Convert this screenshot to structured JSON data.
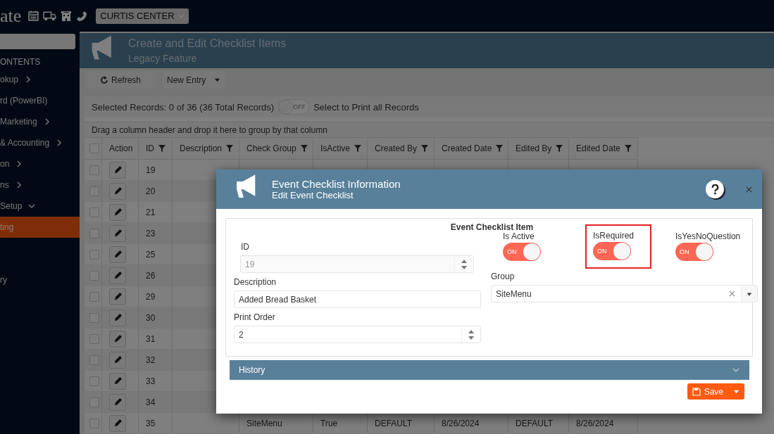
{
  "topbar": {
    "logo": "ate",
    "location": "CURTIS CENTER"
  },
  "sidebar": {
    "heading": "ONTENTS",
    "items": [
      {
        "label": "okup",
        "kind": "group",
        "expanded": false,
        "selected": false
      },
      {
        "label": "rd (PowerBI)",
        "kind": "link",
        "selected": false
      },
      {
        "label": "Marketing",
        "kind": "group",
        "expanded": false,
        "selected": false
      },
      {
        "label": "& Accounting",
        "kind": "group",
        "expanded": false,
        "selected": false
      },
      {
        "label": "on",
        "kind": "group",
        "expanded": false,
        "selected": false
      },
      {
        "label": "ns",
        "kind": "group",
        "expanded": false,
        "selected": false
      },
      {
        "label": "Setup",
        "kind": "group",
        "expanded": true,
        "selected": false
      },
      {
        "label": "ting",
        "kind": "link",
        "selected": true
      },
      {
        "label": "ry",
        "kind": "link",
        "selected": false
      }
    ]
  },
  "page_header": {
    "title": "Create and Edit Checklist Items",
    "subtitle": "Legacy Feature"
  },
  "toolbar": {
    "refresh": "Refresh",
    "new_entry": "New Entry"
  },
  "selection_bar": {
    "summary": "Selected Records: 0 of 36 (36 Total Records)",
    "print_toggle": {
      "text": "OFF",
      "on": false
    },
    "print_label": "Select to Print all Records"
  },
  "group_hint": "Drag a column header and drop it here to group by that column",
  "table": {
    "select_all_checked": false,
    "columns": [
      {
        "label": "Action",
        "kind": "action",
        "filterable": false
      },
      {
        "label": "ID",
        "kind": "text",
        "filterable": true
      },
      {
        "label": "Description",
        "kind": "text",
        "filterable": true
      },
      {
        "label": "Check Group",
        "kind": "text",
        "filterable": true
      },
      {
        "label": "IsActive",
        "kind": "text",
        "filterable": true
      },
      {
        "label": "Created By",
        "kind": "text",
        "filterable": true
      },
      {
        "label": "Created Date",
        "kind": "text",
        "filterable": true
      },
      {
        "label": "Edited By",
        "kind": "text",
        "filterable": true
      },
      {
        "label": "Edited Date",
        "kind": "text",
        "filterable": true
      }
    ],
    "rows": [
      {
        "checked": false,
        "cells": [
          null,
          "19"
        ]
      },
      {
        "checked": false,
        "cells": [
          null,
          "20"
        ]
      },
      {
        "checked": false,
        "cells": [
          null,
          "21"
        ]
      },
      {
        "checked": false,
        "cells": [
          null,
          "23"
        ]
      },
      {
        "checked": false,
        "cells": [
          null,
          "25"
        ]
      },
      {
        "checked": false,
        "cells": [
          null,
          "26"
        ]
      },
      {
        "checked": false,
        "cells": [
          null,
          "29"
        ]
      },
      {
        "checked": false,
        "cells": [
          null,
          "30"
        ]
      },
      {
        "checked": false,
        "cells": [
          null,
          "31"
        ]
      },
      {
        "checked": false,
        "cells": [
          null,
          "32"
        ]
      },
      {
        "checked": false,
        "cells": [
          null,
          "33"
        ]
      },
      {
        "checked": false,
        "cells": [
          null,
          "34"
        ]
      },
      {
        "checked": false,
        "cells": [
          null,
          "35",
          null,
          "SiteMenu",
          "True",
          "DEFAULT",
          "8/26/2024",
          "DEFAULT",
          "8/26/2024"
        ]
      }
    ]
  },
  "dialog": {
    "title": "Event Checklist Information",
    "subtitle": "Edit Event Checklist",
    "section_title": "Event Checklist Item",
    "id_field": {
      "label": "ID",
      "value": "19",
      "disabled": true
    },
    "description_field": {
      "label": "Description",
      "value": "Added Bread Basket"
    },
    "print_order_field": {
      "label": "Print Order",
      "value": "2"
    },
    "toggles": [
      {
        "label": "Is Active",
        "text": "ON",
        "on": true,
        "highlighted": false
      },
      {
        "label": "IsRequired",
        "text": "ON",
        "on": true,
        "highlighted": true
      },
      {
        "label": "IsYesNoQuestion",
        "text": "ON",
        "on": true,
        "highlighted": false
      }
    ],
    "group_field": {
      "label": "Group",
      "value": "SiteMenu"
    },
    "history": {
      "label": "History",
      "expanded": false
    },
    "save": "Save"
  }
}
